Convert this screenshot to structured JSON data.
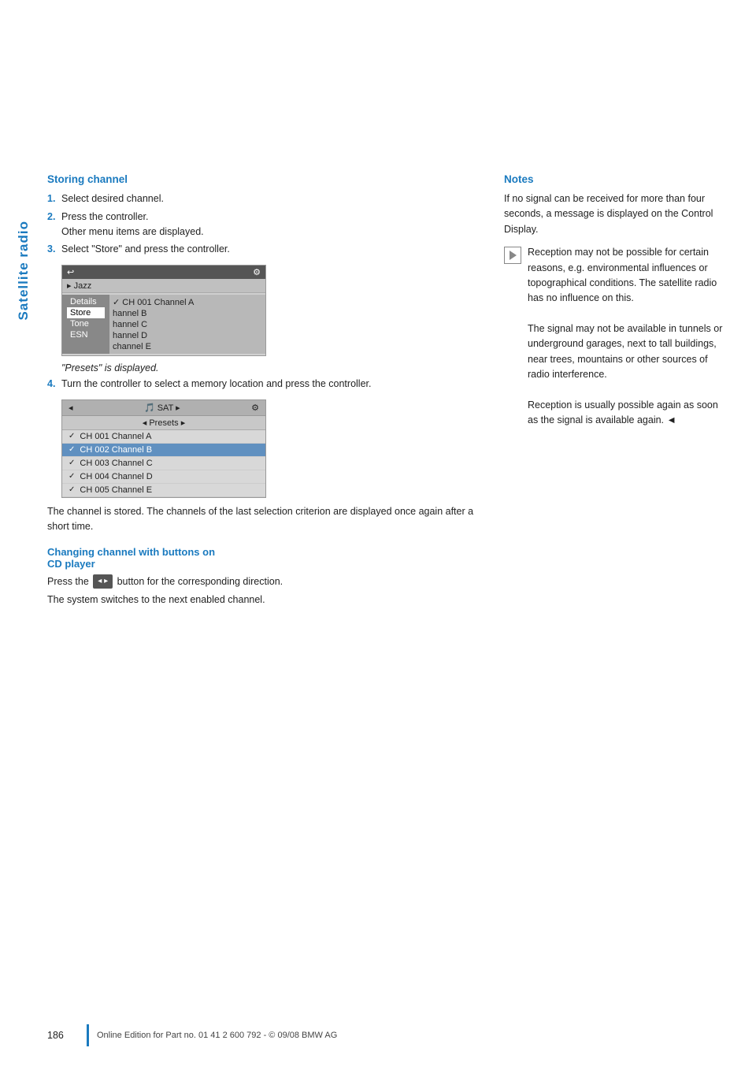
{
  "sidebar": {
    "label": "Satellite radio"
  },
  "left": {
    "storing_channel": {
      "title": "Storing channel",
      "steps": [
        {
          "num": "1.",
          "text": "Select desired channel."
        },
        {
          "num": "2.",
          "text": "Press the controller.\nOther menu items are displayed."
        },
        {
          "num": "3.",
          "text": "Select \"Store\" and press the controller."
        }
      ],
      "screen1": {
        "top_bar_left": "↩",
        "top_bar_right": "⚙",
        "jazz": "▸ Jazz",
        "ch_row": "✓ CH 001 Channel A",
        "menu_items": [
          "Details",
          "Store",
          "Tone",
          "ESN"
        ],
        "channels": [
          "hannel B",
          "hannel C",
          "hannel D",
          "channel E"
        ]
      },
      "presets_displayed": "\"Presets\" is displayed.",
      "step4": {
        "num": "4.",
        "text": "Turn the controller to select a memory location and press the controller."
      },
      "screen2": {
        "top_left": "◂",
        "top_middle": "🎵 SAT",
        "top_right": "▸",
        "top_icon": "⚙",
        "presets": "◂ Presets ▸",
        "channels": [
          {
            "check": "✓",
            "name": "CH 001 Channel A",
            "highlighted": false
          },
          {
            "check": "✓",
            "name": "CH 002 Channel B",
            "highlighted": true
          },
          {
            "check": "✓",
            "name": "CH 003 Channel C",
            "highlighted": false
          },
          {
            "check": "✓",
            "name": "CH 004 Channel D",
            "highlighted": false
          },
          {
            "check": "✓",
            "name": "CH 005 Channel E",
            "highlighted": false
          }
        ]
      },
      "stored_text": "The channel is stored. The channels of the last selection criterion are displayed once again after a short time."
    },
    "changing_channel": {
      "title": "Changing channel with buttons on\nCD player",
      "body1": "Press the",
      "cd_button": "◂ ▸",
      "body1b": "button for the corresponding direction.",
      "body2": "The system switches to the next enabled channel."
    }
  },
  "right": {
    "notes_title": "Notes",
    "note1": "If no signal can be received for more than four seconds, a message is displayed on the Control Display.",
    "note2": "Reception may not be possible for certain reasons, e.g. environmental influences or topographical conditions. The satellite radio has no influence on this.\nThe signal may not be available in tunnels or underground garages, next to tall buildings, near trees, mountains or other sources of radio interference.\nReception is usually possible again as soon as the signal is available again. ◄"
  },
  "footer": {
    "page_number": "186",
    "footer_text": "Online Edition for Part no. 01 41 2 600 792 - © 09/08 BMW AG"
  }
}
